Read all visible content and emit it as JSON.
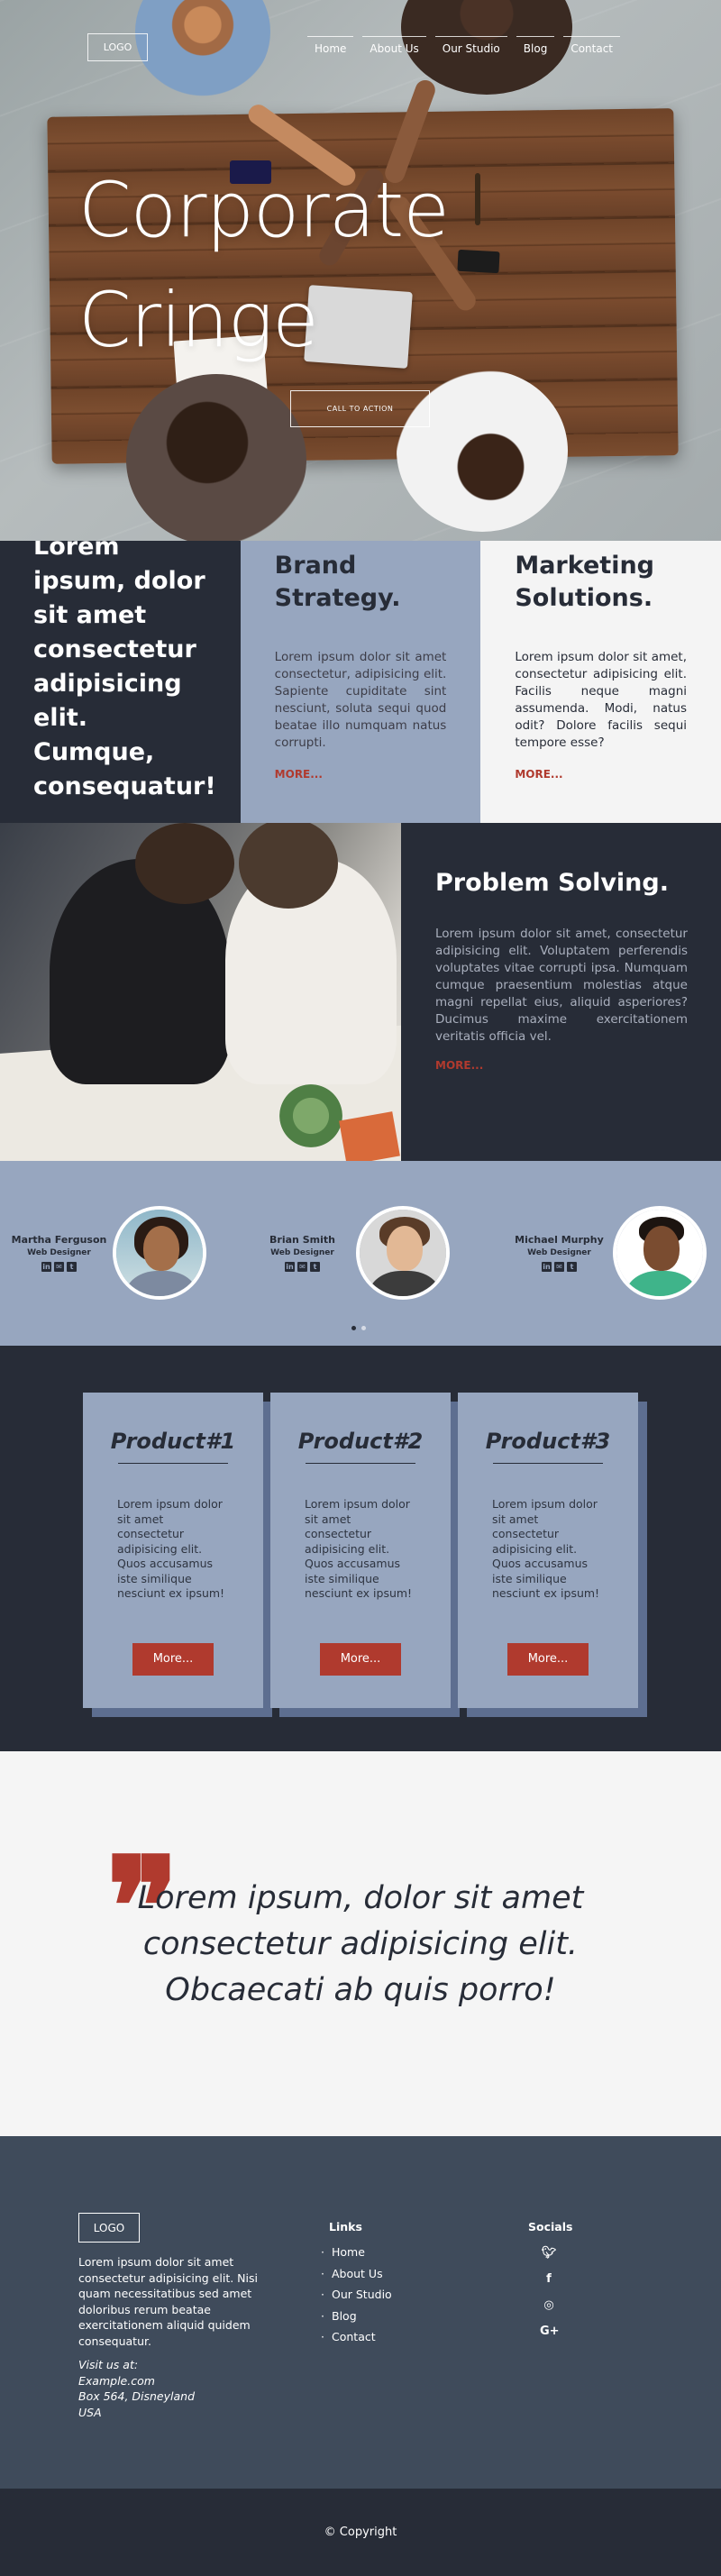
{
  "header": {
    "logo": "LOGO",
    "nav": [
      "Home",
      "About Us",
      "Our Studio",
      "Blog",
      "Contact"
    ]
  },
  "hero": {
    "title_line1": "Corporate",
    "title_line2": "Cringe",
    "cta": "CALL TO ACTION"
  },
  "features": {
    "intro": "Lorem ipsum, dolor sit amet consectetur adipisicing elit. Cumque, consequatur!",
    "brand": {
      "title": "Brand Strategy.",
      "text": "Lorem ipsum dolor sit amet consectetur, adipisicing elit. Sapiente cupiditate sint nesciunt, soluta sequi quod beatae illo numquam natus corrupti.",
      "more": "MORE..."
    },
    "marketing": {
      "title": "Marketing Solutions.",
      "text": "Lorem ipsum dolor sit amet, consectetur adipisicing elit. Facilis neque magni assumenda. Modi, natus odit? Dolore facilis sequi tempore esse?",
      "more": "MORE..."
    }
  },
  "problem": {
    "title": "Problem Solving.",
    "text": "Lorem ipsum dolor sit amet, consectetur adipisicing elit. Voluptatem perferendis voluptates vitae corrupti ipsa. Numquam cumque praesentium molestias atque magni repellat eius, aliquid asperiores? Ducimus maxime exercitationem veritatis officia vel.",
    "more": "MORE..."
  },
  "team": {
    "members": [
      {
        "name": "Martha Ferguson",
        "role": "Web Designer"
      },
      {
        "name": "Brian Smith",
        "role": "Web Designer"
      },
      {
        "name": "Michael Murphy",
        "role": "Web Designer"
      }
    ],
    "social_icons": [
      "linkedin-icon",
      "email-icon",
      "twitter-icon"
    ]
  },
  "products": [
    {
      "title": "Product#1",
      "text": "Lorem ipsum dolor sit amet consectetur adipisicing elit. Quos accusamus iste similique nesciunt ex ipsum!",
      "button": "More..."
    },
    {
      "title": "Product#2",
      "text": "Lorem ipsum dolor sit amet consectetur adipisicing elit. Quos accusamus iste similique nesciunt ex ipsum!",
      "button": "More..."
    },
    {
      "title": "Product#3",
      "text": "Lorem ipsum dolor sit amet consectetur adipisicing elit. Quos accusamus iste similique nesciunt ex ipsum!",
      "button": "More..."
    }
  ],
  "quote": {
    "text": "Lorem ipsum, dolor sit amet consectetur adipisicing elit. Obcaecati ab quis porro!"
  },
  "footer": {
    "logo": "LOGO",
    "about": "Lorem ipsum dolor sit amet consectetur adipisicing elit. Nisi quam necessitatibus sed amet doloribus rerum beatae exercitationem aliquid quidem consequatur.",
    "address": [
      "Visit us at:",
      "Example.com",
      "Box 564, Disneyland",
      "USA"
    ],
    "links_heading": "Links",
    "links": [
      "Home",
      "About Us",
      "Our Studio",
      "Blog",
      "Contact"
    ],
    "socials_heading": "Socials",
    "socials": [
      "twitter-icon",
      "facebook-icon",
      "instagram-icon",
      "google-plus-icon"
    ],
    "copyright": "© Copyright"
  },
  "colors": {
    "dark": "#272c37",
    "steel_blue": "#97a6bf",
    "accent_red": "#b03a2e",
    "footer_bg": "#3f4b5b",
    "light": "#f4f4f4"
  }
}
